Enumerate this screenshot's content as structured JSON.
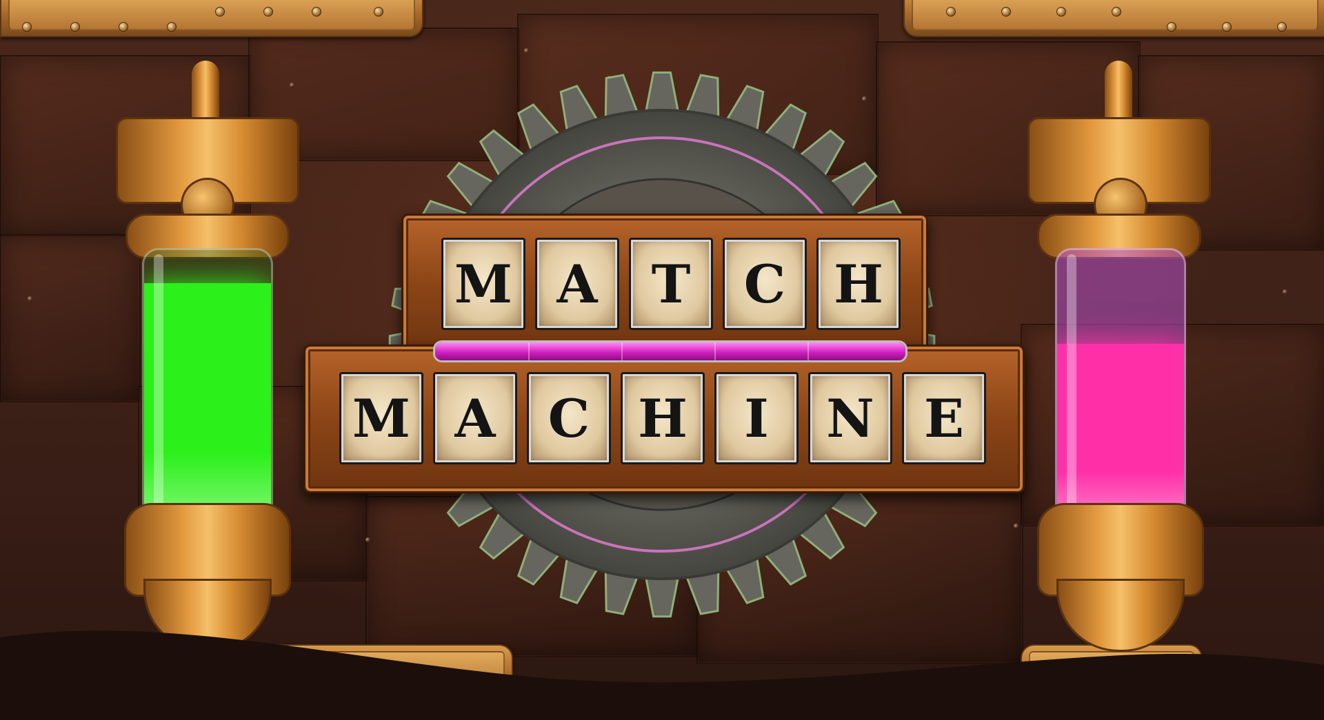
{
  "title": {
    "line1": [
      "M",
      "A",
      "T",
      "C",
      "H"
    ],
    "line2": [
      "M",
      "A",
      "C",
      "H",
      "I",
      "N",
      "E"
    ]
  },
  "progress_bar": {
    "fill_percent": 100,
    "color": "#d21fc0"
  },
  "left_tube": {
    "liquid_color": "#2cf01a",
    "fill_fraction": 0.88
  },
  "right_tube": {
    "liquid_color": "#ff2fa8",
    "fill_fraction": 0.66
  },
  "colors": {
    "brass": "#c98a3a",
    "background": "#3c2017",
    "gear": "#6c6c64"
  }
}
